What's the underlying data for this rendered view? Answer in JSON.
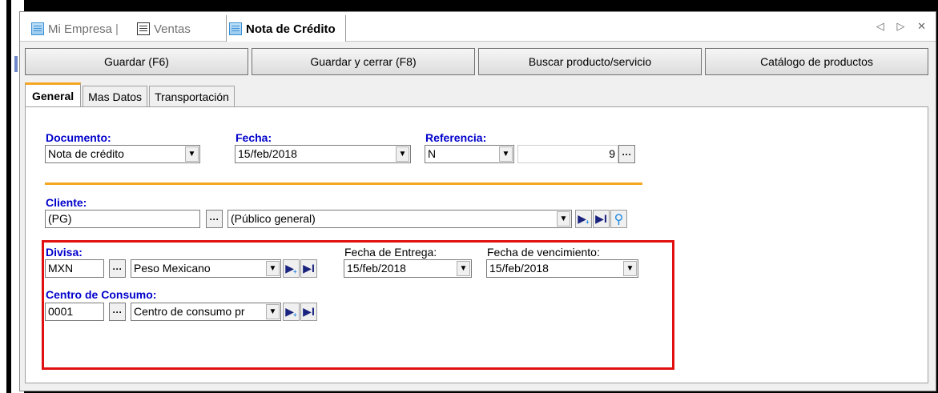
{
  "tabs": [
    {
      "label": "Mi Empresa"
    },
    {
      "label": "Ventas"
    },
    {
      "label": "Nota de Crédito"
    }
  ],
  "window_controls": "◁ ▷ ✕",
  "toolbar": {
    "save": "Guardar (F6)",
    "save_close": "Guardar y cerrar (F8)",
    "search_product": "Buscar producto/servicio",
    "catalog": "Catálogo de productos"
  },
  "page_tabs": [
    "General",
    "Mas Datos",
    "Transportación"
  ],
  "form": {
    "documento": {
      "label": "Documento:",
      "value": "Nota de crédito"
    },
    "fecha": {
      "label": "Fecha:",
      "value": "15/feb/2018"
    },
    "referencia": {
      "label": "Referencia:",
      "serie": "N",
      "folio": "9"
    },
    "cliente": {
      "label": "Cliente:",
      "code": "(PG)",
      "name": "(Público general)"
    },
    "divisa": {
      "label": "Divisa:",
      "code": "MXN",
      "name": "Peso Mexicano"
    },
    "fecha_entrega": {
      "label": "Fecha de Entrega:",
      "value": "15/feb/2018"
    },
    "fecha_vencimiento": {
      "label": "Fecha de vencimiento:",
      "value": "15/feb/2018"
    },
    "centro_consumo": {
      "label": "Centro de Consumo:",
      "code": "0001",
      "name": "Centro de consumo pr"
    }
  },
  "colors": {
    "label_blue": "#0000cc",
    "accent_orange": "#f5a623",
    "highlight_red": "#e01010"
  },
  "icons": {
    "ellipsis": "···",
    "dropdown": "▼"
  }
}
